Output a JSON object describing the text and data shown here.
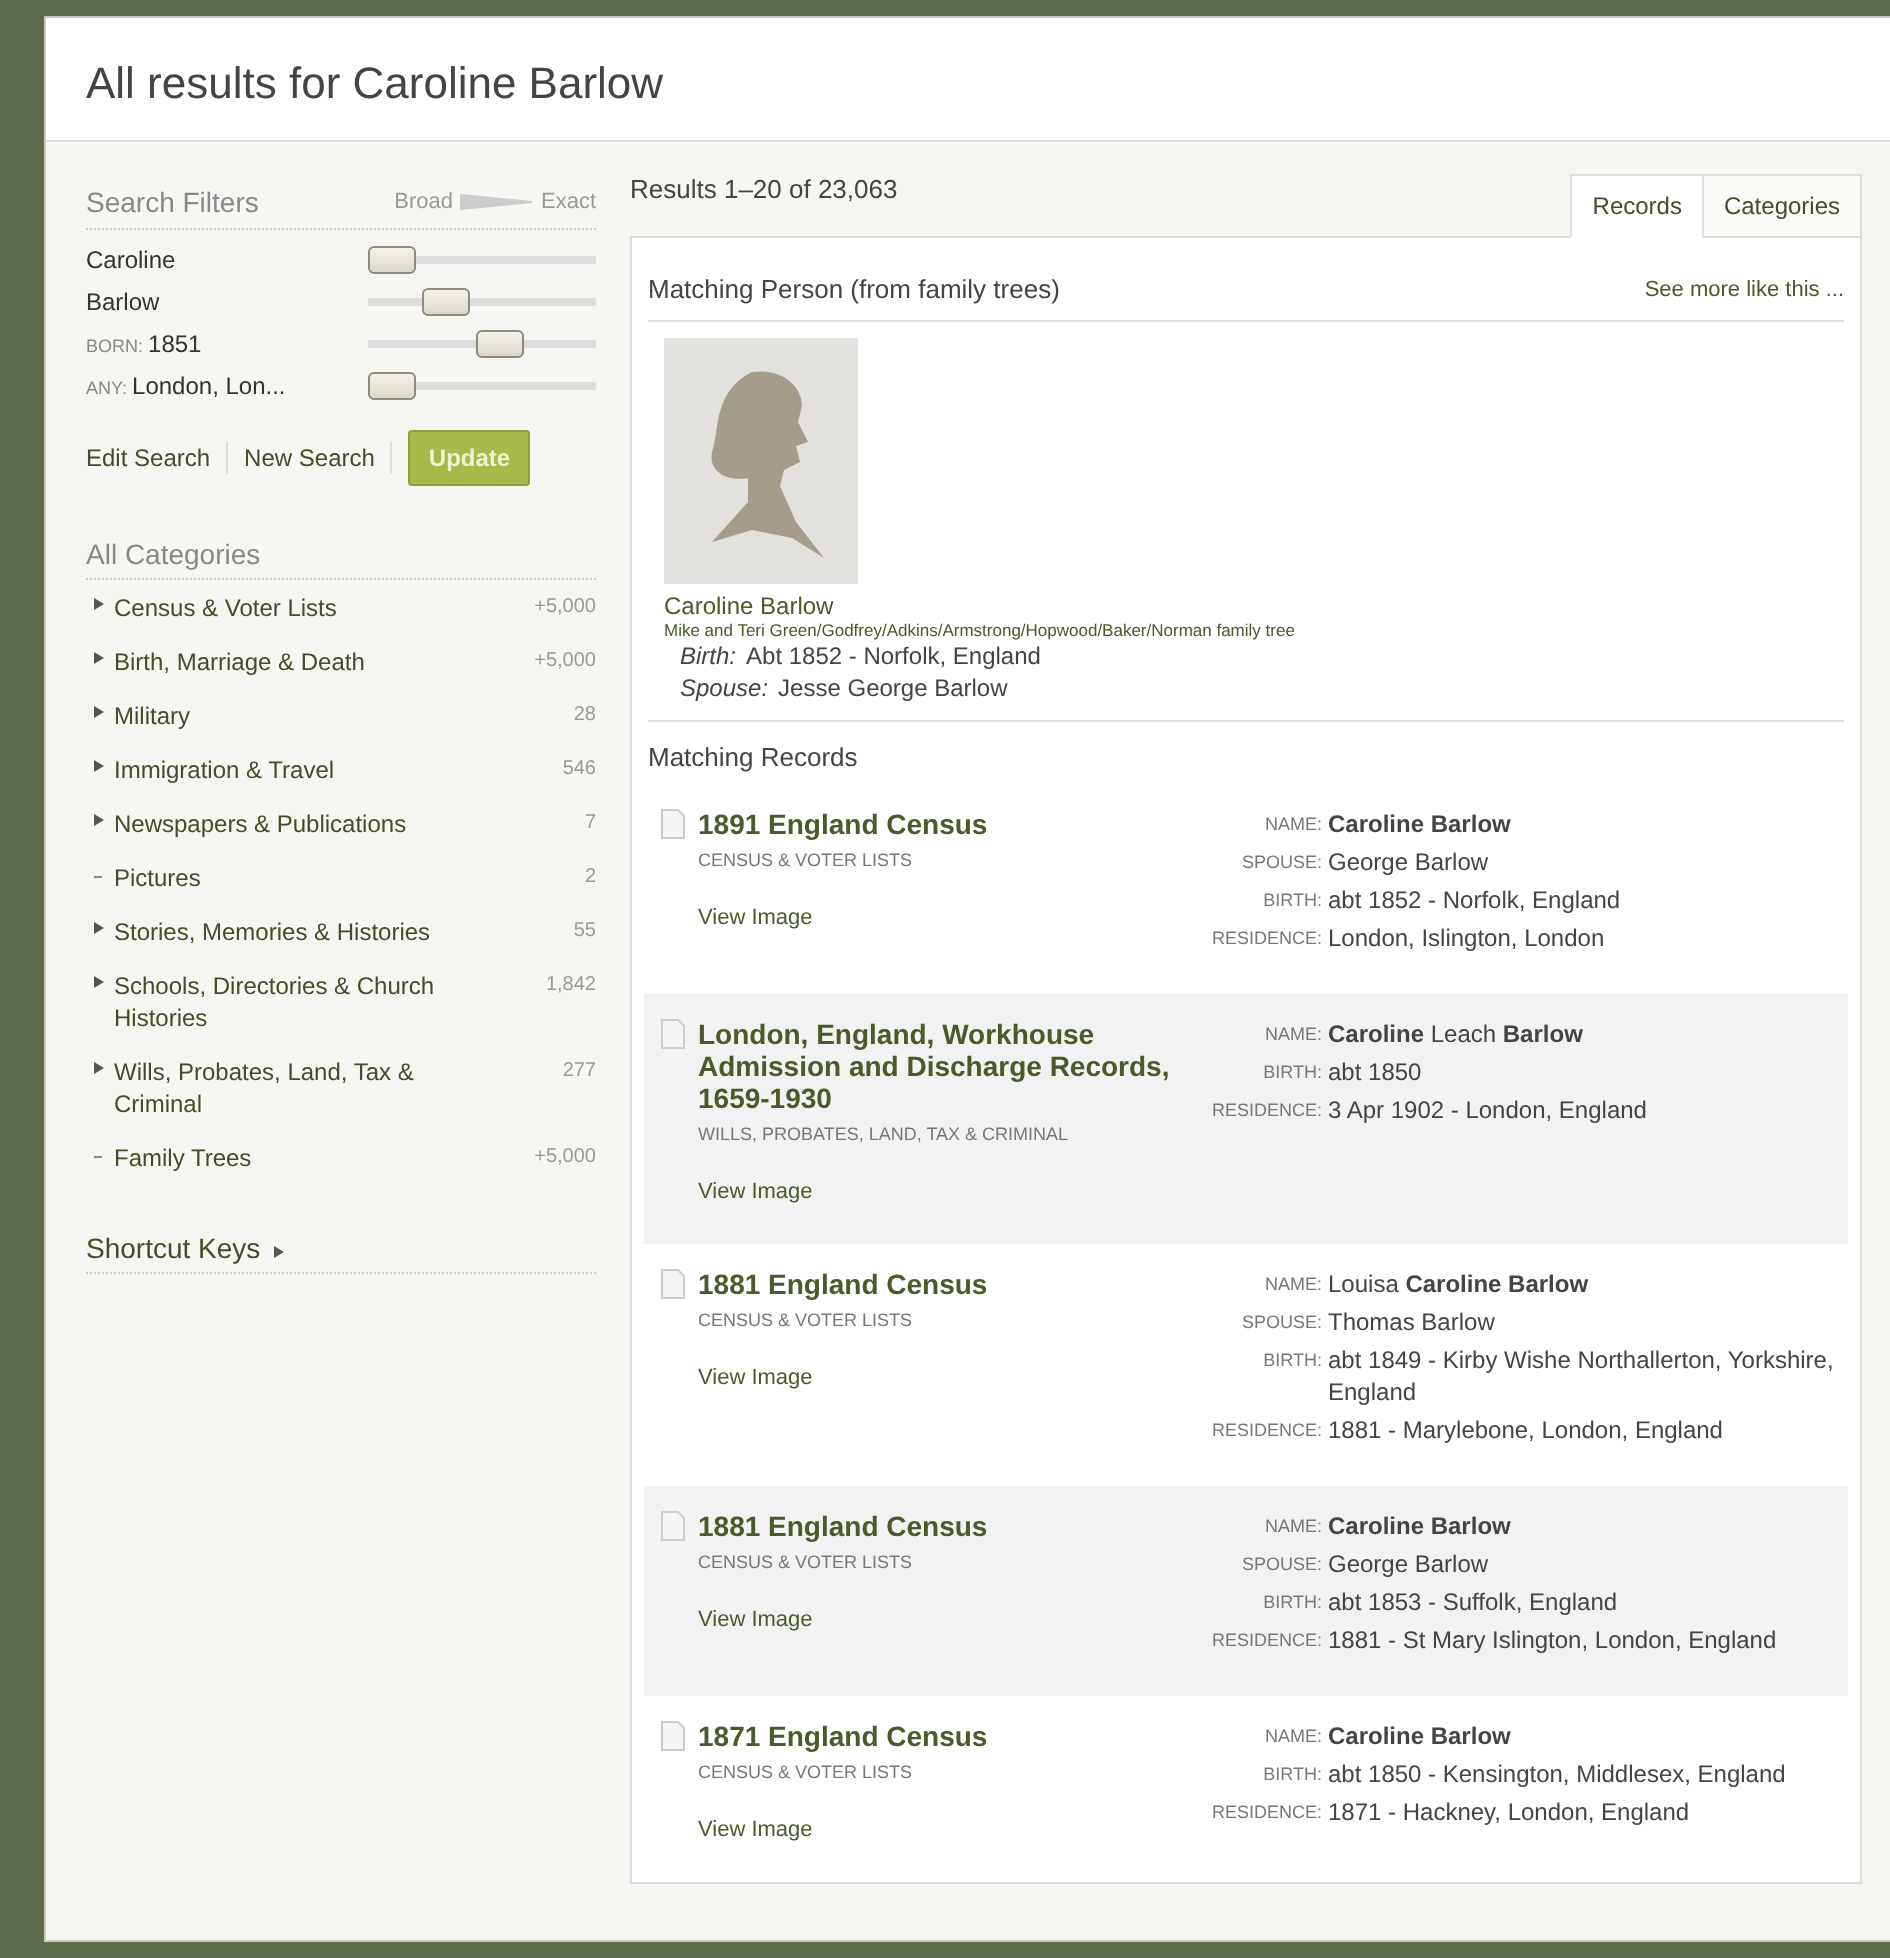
{
  "page_title": "All results for Caroline Barlow",
  "filters": {
    "title": "Search Filters",
    "broad_label": "Broad",
    "exact_label": "Exact",
    "items": [
      {
        "value": "Caroline",
        "level": 0
      },
      {
        "value": "Barlow",
        "level": 0.3
      },
      {
        "prefix": "BORN:",
        "value": "1851",
        "level": 0.6
      },
      {
        "prefix": "ANY:",
        "value": "London, Lon...",
        "level": 0
      }
    ],
    "links": [
      "Edit Search",
      "New Search"
    ],
    "update_button": "Update"
  },
  "categories": {
    "title": "All Categories",
    "items": [
      {
        "label": "Census & Voter Lists",
        "count": "+5,000",
        "expandable": true
      },
      {
        "label": "Birth, Marriage & Death",
        "count": "+5,000",
        "expandable": true
      },
      {
        "label": "Military",
        "count": "28",
        "expandable": true
      },
      {
        "label": "Immigration & Travel",
        "count": "546",
        "expandable": true
      },
      {
        "label": "Newspapers & Publications",
        "count": "7",
        "expandable": true
      },
      {
        "label": "Pictures",
        "count": "2",
        "expandable": false
      },
      {
        "label": "Stories, Memories & Histories",
        "count": "55",
        "expandable": true
      },
      {
        "label": "Schools, Directories & Church Histories",
        "count": "1,842",
        "expandable": true
      },
      {
        "label": "Wills, Probates, Land, Tax & Criminal",
        "count": "277",
        "expandable": true
      },
      {
        "label": "Family Trees",
        "count": "+5,000",
        "expandable": false
      }
    ]
  },
  "shortcut_keys": "Shortcut Keys",
  "results_count": "Results 1–20 of 23,063",
  "tabs": [
    {
      "label": "Records",
      "selected": true
    },
    {
      "label": "Categories",
      "selected": false
    }
  ],
  "matching_person": {
    "heading": "Matching Person (from family trees)",
    "see_more": "See more like this ...",
    "name": "Caroline Barlow",
    "tree": "Mike and Teri Green/Godfrey/Adkins/Armstrong/Hopwood/Baker/Norman family tree",
    "facts": [
      {
        "label": "Birth:",
        "value": "Abt 1852 - Norfolk, England"
      },
      {
        "label": "Spouse:",
        "value": "Jesse George Barlow"
      }
    ]
  },
  "records_heading": "Matching Records",
  "records": [
    {
      "title": "1891 England Census",
      "category": "CENSUS & VOTER LISTS",
      "view_image": "View Image",
      "fields": [
        {
          "label": "NAME:",
          "value": "**Caroline Barlow**"
        },
        {
          "label": "SPOUSE:",
          "value": "George Barlow"
        },
        {
          "label": "BIRTH:",
          "value": "abt 1852 - Norfolk, England"
        },
        {
          "label": "RESIDENCE:",
          "value": "London, Islington, London"
        }
      ]
    },
    {
      "title": "London, England, Workhouse Admission and Discharge Records, 1659-1930",
      "category": "WILLS, PROBATES, LAND, TAX & CRIMINAL",
      "view_image": "View Image",
      "fields": [
        {
          "label": "NAME:",
          "value": "**Caroline** Leach **Barlow**"
        },
        {
          "label": "BIRTH:",
          "value": "abt 1850"
        },
        {
          "label": "RESIDENCE:",
          "value": "3 Apr 1902 - London, England"
        }
      ]
    },
    {
      "title": "1881 England Census",
      "category": "CENSUS & VOTER LISTS",
      "view_image": "View Image",
      "fields": [
        {
          "label": "NAME:",
          "value": "Louisa **Caroline Barlow**"
        },
        {
          "label": "SPOUSE:",
          "value": "Thomas Barlow"
        },
        {
          "label": "BIRTH:",
          "value": "abt 1849 - Kirby Wishe Northallerton, Yorkshire, England"
        },
        {
          "label": "RESIDENCE:",
          "value": "1881 - Marylebone, London, England"
        }
      ]
    },
    {
      "title": "1881 England Census",
      "category": "CENSUS & VOTER LISTS",
      "view_image": "View Image",
      "fields": [
        {
          "label": "NAME:",
          "value": "**Caroline Barlow**"
        },
        {
          "label": "SPOUSE:",
          "value": "George Barlow"
        },
        {
          "label": "BIRTH:",
          "value": "abt 1853 - Suffolk, England"
        },
        {
          "label": "RESIDENCE:",
          "value": "1881 - St Mary Islington, London, England"
        }
      ]
    },
    {
      "title": "1871 England Census",
      "category": "CENSUS & VOTER LISTS",
      "view_image": "View Image",
      "fields": [
        {
          "label": "NAME:",
          "value": "**Caroline Barlow**"
        },
        {
          "label": "BIRTH:",
          "value": "abt 1850 - Kensington, Middlesex, England"
        },
        {
          "label": "RESIDENCE:",
          "value": "1871 - Hackney, London, England"
        }
      ]
    }
  ]
}
